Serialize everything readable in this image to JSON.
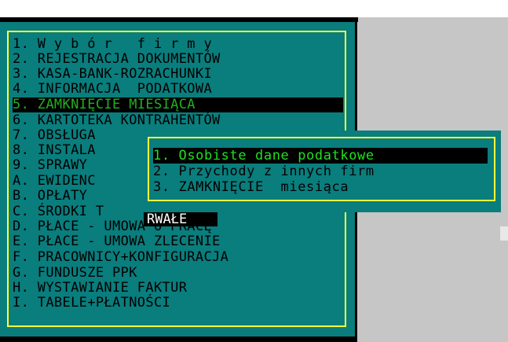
{
  "menu": {
    "items": [
      {
        "label": "1. W y b ó r   f i r m y"
      },
      {
        "label": "2. REJESTRACJA DOKUMENTÓW"
      },
      {
        "label": "3. KASA-BANK-ROZRACHUNKI"
      },
      {
        "label": "4. INFORMACJA  PODATKOWA"
      },
      {
        "label": "5. ZAMKNIĘCIE MIESIĄCA",
        "selected": true
      },
      {
        "label": "6. KARTOTEKA KONTRAHENTÓW"
      },
      {
        "label": "7. OBSŁUGA"
      },
      {
        "label": "8. INSTALA"
      },
      {
        "label": "9. SPRAWY"
      },
      {
        "label": "A. EWIDENC"
      },
      {
        "label": "B. OPŁATY"
      },
      {
        "label": "C. ŚRODKI T"
      },
      {
        "label": "D. PŁACE - UMOWA O PRACĘ"
      },
      {
        "label": "E. PŁACE - UMOWA ZLECENIE"
      },
      {
        "label": "F. PRACOWNICY+KONFIGURACJA"
      },
      {
        "label": "G. FUNDUSZE PPK"
      },
      {
        "label": "H. WYSTAWIANIE FAKTUR"
      },
      {
        "label": "I. TABELE+PŁATNOŚCI"
      }
    ]
  },
  "submenu": {
    "items": [
      {
        "label": "1. Osobiste dane podatkowe",
        "selected": true
      },
      {
        "label": "2. Przychody z innych firm"
      },
      {
        "label": "3. ZAMKNIĘCIE  miesiąca"
      }
    ]
  },
  "field": {
    "value": "RWAŁE"
  },
  "colors": {
    "panel": "#0a7d7d",
    "frame": "#ffff3c",
    "highlight_text": "#20b020",
    "background": "#c6c6c6"
  }
}
